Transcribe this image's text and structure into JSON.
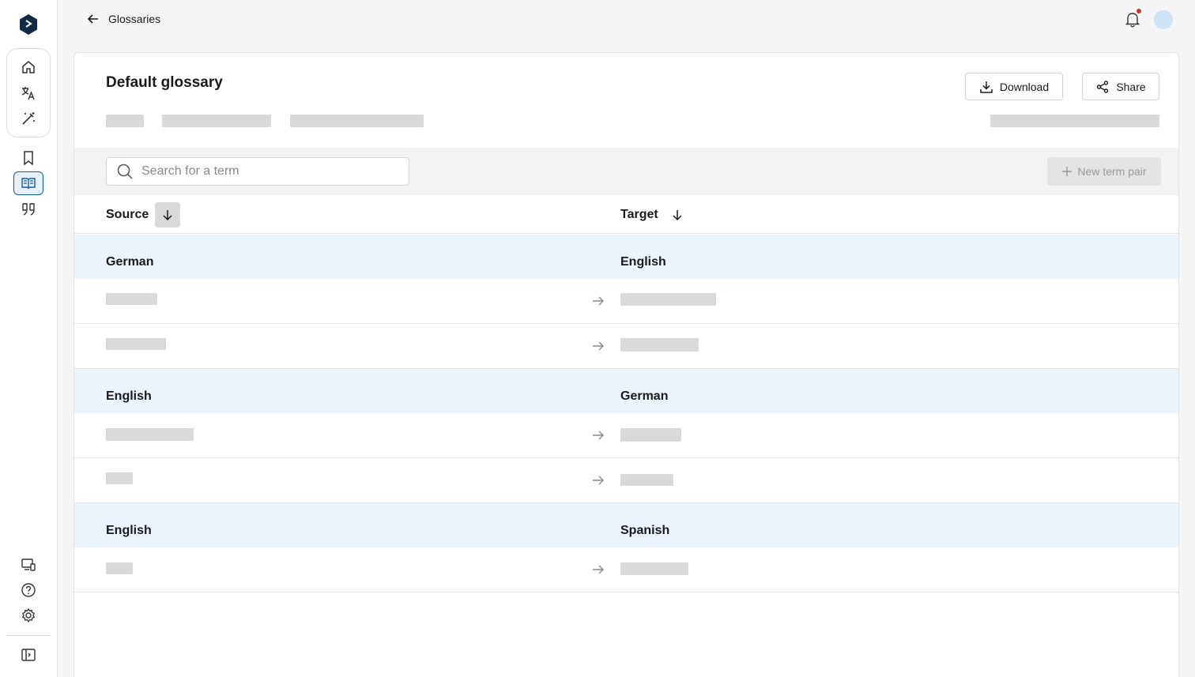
{
  "header": {
    "back_label": "Glossaries"
  },
  "page": {
    "title": "Default glossary",
    "download_label": "Download",
    "share_label": "Share"
  },
  "search": {
    "placeholder": "Search for a term"
  },
  "toolbar": {
    "new_term_label": "New term pair"
  },
  "table": {
    "source_header": "Source",
    "target_header": "Target",
    "groups": [
      {
        "source_lang": "German",
        "target_lang": "English"
      },
      {
        "source_lang": "English",
        "target_lang": "German"
      },
      {
        "source_lang": "English",
        "target_lang": "Spanish"
      }
    ]
  },
  "colors": {
    "accent": "#0f5ea8",
    "group_row_bg": "#ebf3fd",
    "skeleton": "#d9d9d9",
    "notification_dot": "#d0342c"
  },
  "icons": {
    "rail": [
      "logo-icon",
      "home-icon",
      "translate-icon",
      "magic-wand-icon",
      "bookmark-icon",
      "glossary-book-icon",
      "quote-icon",
      "device-icon",
      "help-icon",
      "settings-icon",
      "collapse-sidebar-icon"
    ],
    "header": [
      "back-arrow-icon",
      "bell-icon"
    ]
  }
}
